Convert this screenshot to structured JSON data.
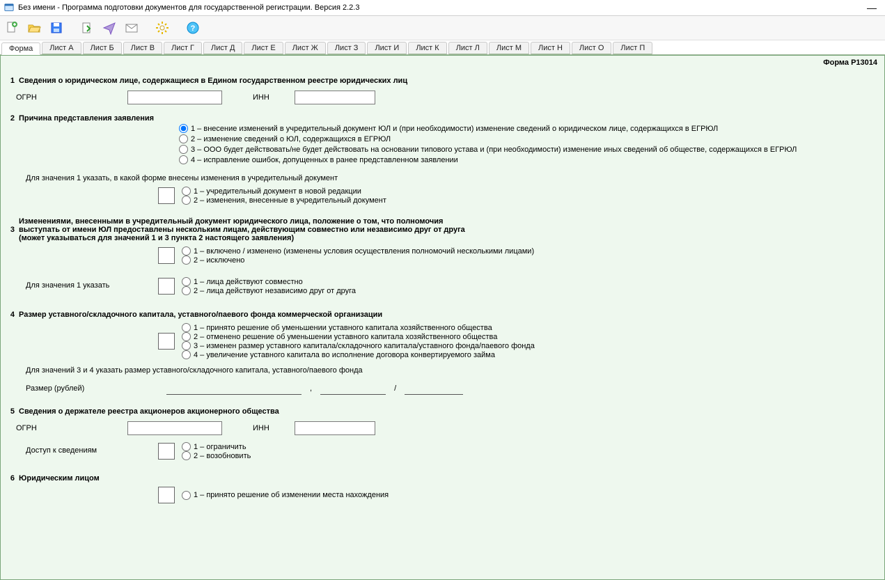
{
  "window": {
    "title": "Без имени - Программа подготовки документов для государственной регистрации. Версия 2.2.3"
  },
  "toolbar_icons": {
    "new": "new-doc-icon",
    "open": "open-folder-icon",
    "save": "save-icon",
    "export": "export-page-icon",
    "print": "send-icon",
    "mail": "mail-icon",
    "settings": "gear-icon",
    "help": "help-icon"
  },
  "tabs": [
    {
      "label": "Форма",
      "active": true
    },
    {
      "label": "Лист А"
    },
    {
      "label": "Лист Б"
    },
    {
      "label": "Лист В"
    },
    {
      "label": "Лист Г"
    },
    {
      "label": "Лист Д"
    },
    {
      "label": "Лист Е"
    },
    {
      "label": "Лист Ж"
    },
    {
      "label": "Лист З"
    },
    {
      "label": "Лист И"
    },
    {
      "label": "Лист К"
    },
    {
      "label": "Лист Л"
    },
    {
      "label": "Лист М"
    },
    {
      "label": "Лист Н"
    },
    {
      "label": "Лист О"
    },
    {
      "label": "Лист П"
    }
  ],
  "form_code": "Форма Р13014",
  "s1": {
    "num": "1",
    "title": "Сведения о юридическом лице, содержащиеся в Едином государственном реестре юридических лиц",
    "ogrn_label": "ОГРН",
    "ogrn_value": "",
    "inn_label": "ИНН",
    "inn_value": ""
  },
  "s2": {
    "num": "2",
    "title": "Причина представления заявления",
    "opts": [
      "1 – внесение изменений в учредительный документ ЮЛ и (при необходимости) изменение сведений о юридическом лице, содержащихся в ЕГРЮЛ",
      "2 – изменение сведений о ЮЛ, содержащихся в ЕГРЮЛ",
      "3 – ООО будет действовать/не будет действовать на основании типового устава и (при необходимости) изменение иных сведений об обществе, содержащихся в ЕГРЮЛ",
      "4 – исправление ошибок, допущенных в ранее представленном заявлении"
    ],
    "selected": 0,
    "sub_note": "Для значения 1 указать, в какой форме внесены изменения в учредительный документ",
    "sub_opts": [
      "1 – учредительный документ в новой редакции",
      "2 – изменения, внесенные в учредительный документ"
    ]
  },
  "s3": {
    "num": "3",
    "pre_line": "Изменениями, внесенными в учредительный документ юридического лица, положение о том, что полномочия",
    "title": "выступать от имени ЮЛ предоставлены нескольким лицам, действующим совместно или независимо друг от друга",
    "post_line": "(может указываться для значений 1 и 3 пункта 2 настоящего заявления)",
    "opts_a": [
      "1 – включено / изменено (изменены условия осуществления полномочий несколькими лицами)",
      "2 – исключено"
    ],
    "lead_b": "Для значения 1 указать",
    "opts_b": [
      "1 – лица действуют совместно",
      "2 – лица действуют независимо друг от друга"
    ]
  },
  "s4": {
    "num": "4",
    "title": "Размер уставного/складочного капитала, уставного/паевого фонда коммерческой организации",
    "opts": [
      "1 – принято решение об уменьшении уставного капитала хозяйственного общества",
      "2 – отменено решение об уменьшении уставного капитала хозяйственного общества",
      "3 – изменен размер уставного капитала/складочного капитала/уставного фонда/паевого фонда",
      "4 – увеличение уставного капитала во исполнение договора конвертируемого займа"
    ],
    "sub_note": "Для значений 3 и 4 указать размер уставного/складочного капитала, уставного/паевого фонда",
    "amount_label": "Размер (рублей)",
    "amount_int": "",
    "amount_sep": ",",
    "amount_dec": "",
    "slash": "/",
    "amount_denom": ""
  },
  "s5": {
    "num": "5",
    "title": "Сведения о держателе реестра акционеров акционерного общества",
    "ogrn_label": "ОГРН",
    "ogrn_value": "",
    "inn_label": "ИНН",
    "inn_value": "",
    "access_label": "Доступ к сведениям",
    "access_opts": [
      "1 – ограничить",
      "2 – возобновить"
    ]
  },
  "s6": {
    "num": "6",
    "title": "Юридическим лицом",
    "opts": [
      "1 – принято решение об изменении места нахождения"
    ]
  }
}
